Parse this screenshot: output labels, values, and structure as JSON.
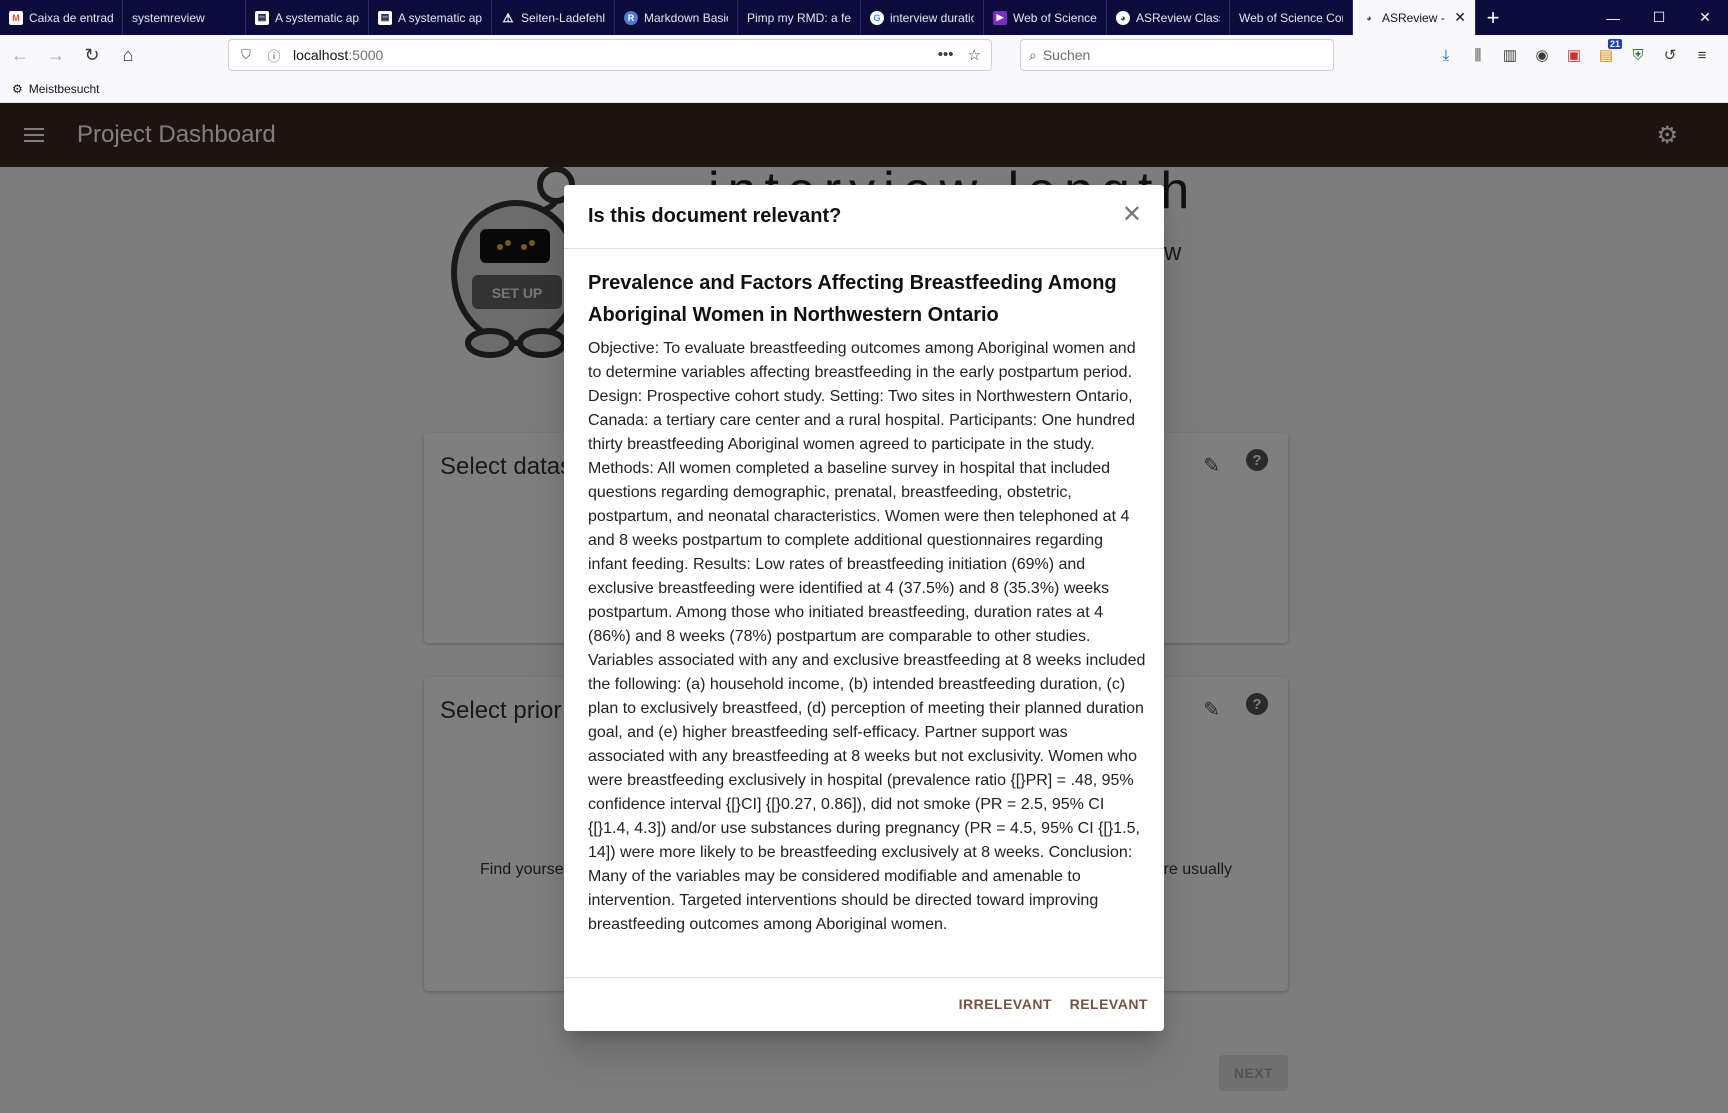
{
  "browser": {
    "tabs": [
      {
        "label": "Caixa de entrada",
        "favicon": "gmail-icon",
        "color": "#ea4335"
      },
      {
        "label": "systemreview",
        "favicon": "",
        "color": ""
      },
      {
        "label": "A systematic approach",
        "favicon": "document-icon",
        "color": "#ffffff"
      },
      {
        "label": "A systematic approach",
        "favicon": "document-icon",
        "color": "#ffffff"
      },
      {
        "label": "Seiten-Ladefehler",
        "favicon": "warning-icon",
        "color": "#ffffff"
      },
      {
        "label": "Markdown Basics",
        "favicon": "r-icon",
        "color": "#4a7ad1"
      },
      {
        "label": "Pimp my RMD: a few tips",
        "favicon": "",
        "color": ""
      },
      {
        "label": "interview duration",
        "favicon": "google-icon",
        "color": "#4285f4"
      },
      {
        "label": "Web of Science",
        "favicon": "wos-icon",
        "color": "#7b2cbf"
      },
      {
        "label": "ASReview Classification",
        "favicon": "asreview-icon",
        "color": "#ffffff"
      },
      {
        "label": "Web of Science Core",
        "favicon": "",
        "color": ""
      },
      {
        "label": "ASReview - ",
        "favicon": "asreview-icon",
        "color": "#444444",
        "active": true
      }
    ],
    "url_host": "localhost",
    "url_port": ":5000",
    "search_placeholder": "Suchen",
    "bookmark_label": "Meistbesucht",
    "addon_badge": "21"
  },
  "app": {
    "title": "Project Dashboard",
    "page_title": "interview length",
    "page_subtitle": "eview",
    "robot_label": "SET UP",
    "accent_color": "#3e2723",
    "cards": [
      {
        "title": "Select datas"
      },
      {
        "title": "Select prior",
        "text_left": "Find yourse",
        "text_right": "re usually"
      }
    ],
    "next_label": "NEXT"
  },
  "dialog": {
    "title": "Is this document relevant?",
    "close_icon": "close-icon",
    "doc_title": "Prevalence and Factors Affecting Breastfeeding Among Aboriginal Women in Northwestern Ontario",
    "abstract": "Objective: To evaluate breastfeeding outcomes among Aboriginal women and to determine variables affecting breastfeeding in the early postpartum period. Design: Prospective cohort study. Setting: Two sites in Northwestern Ontario, Canada: a tertiary care center and a rural hospital. Participants: One hundred thirty breastfeeding Aboriginal women agreed to participate in the study. Methods: All women completed a baseline survey in hospital that included questions regarding demographic, prenatal, breastfeeding, obstetric, postpartum, and neonatal characteristics. Women were then telephoned at 4 and 8 weeks postpartum to complete additional questionnaires regarding infant feeding. Results: Low rates of breastfeeding initiation (69%) and exclusive breastfeeding were identified at 4 (37.5%) and 8 (35.3%) weeks postpartum. Among those who initiated breastfeeding, duration rates at 4 (86%) and 8 weeks (78%) postpartum are comparable to other studies. Variables associated with any and exclusive breastfeeding at 8 weeks included the following: (a) household income, (b) intended breastfeeding duration, (c) plan to exclusively breastfeed, (d) perception of meeting their planned duration goal, and (e) higher breastfeeding self-efficacy. Partner support was associated with any breastfeeding at 8 weeks but not exclusivity. Women who were breastfeeding exclusively in hospital (prevalence ratio {[}PR] = .48, 95% confidence interval {[}CI] {[}0.27, 0.86]), did not smoke (PR = 2.5, 95% CI {[}1.4, 4.3]) and/or use substances during pregnancy (PR = 4.5, 95% CI {[}1.5, 14]) were more likely to be breastfeeding exclusively at 8 weeks. Conclusion: Many of the variables may be considered modifiable and amenable to intervention. Targeted interventions should be directed toward improving breastfeeding outcomes among Aboriginal women.",
    "irrelevant_label": "IRRELEVANT",
    "relevant_label": "RELEVANT"
  }
}
